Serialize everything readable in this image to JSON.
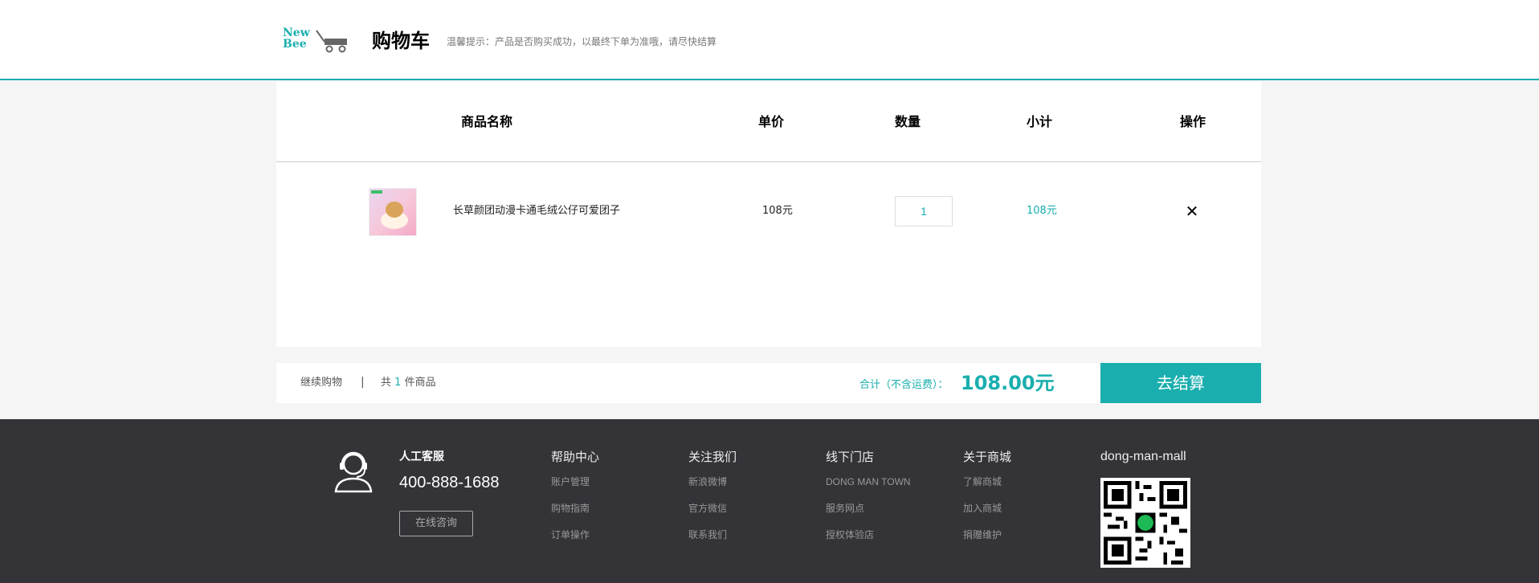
{
  "header": {
    "logo": "New Bee",
    "title": "购物车",
    "tip": "温馨提示：产品是否购买成功，以最终下单为准哦，请尽快结算"
  },
  "table": {
    "columns": [
      "商品名称",
      "单价",
      "数量",
      "小计",
      "操作"
    ],
    "item": {
      "name": "长草颜团动漫卡通毛绒公仔可爱团子",
      "price": "108元",
      "quantity": "1",
      "subtotal": "108元"
    }
  },
  "summary": {
    "continue_label": "继续购物",
    "separator": "|",
    "count_prefix": "共",
    "count": "1",
    "count_suffix": "件商品",
    "total_label": "合计（不含运费）：",
    "total_value": "108.00元",
    "checkout_label": "去结算"
  },
  "footer": {
    "service_label": "人工客服",
    "phone": "400-888-1688",
    "consult_label": "在线咨询",
    "columns": [
      {
        "title": "帮助中心",
        "links": [
          "账户管理",
          "购物指南",
          "订单操作"
        ]
      },
      {
        "title": "关注我们",
        "links": [
          "新浪微博",
          "官方微信",
          "联系我们"
        ]
      },
      {
        "title": "线下门店",
        "links": [
          "DONG MAN TOWN",
          "服务网点",
          "授权体验店"
        ]
      },
      {
        "title": "关于商城",
        "links": [
          "了解商城",
          "加入商城",
          "捐赠维护"
        ]
      }
    ],
    "brand": "dong-man-mall"
  },
  "colors": {
    "accent": "#1baeae",
    "footer_bg": "#333338"
  },
  "icons": [
    "cart-logo-icon",
    "close-icon",
    "customer-service-icon",
    "qr-code-icon"
  ]
}
